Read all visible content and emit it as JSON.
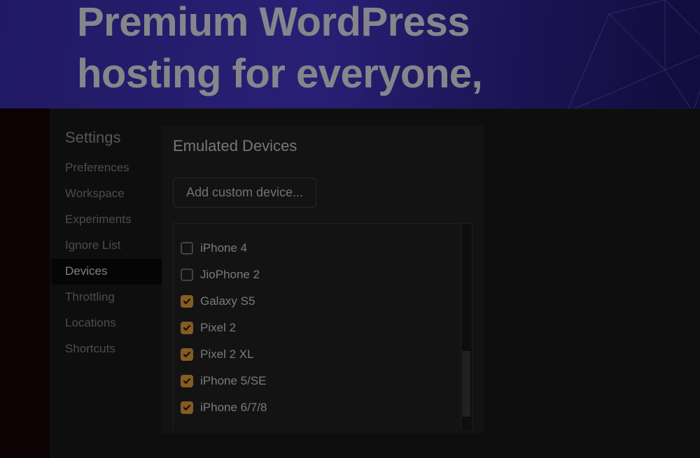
{
  "hero": {
    "title_line1": "Premium WordPress",
    "title_line2": "hosting for everyone,"
  },
  "sidebar": {
    "heading": "Settings",
    "items": [
      {
        "label": "Preferences",
        "active": false
      },
      {
        "label": "Workspace",
        "active": false
      },
      {
        "label": "Experiments",
        "active": false
      },
      {
        "label": "Ignore List",
        "active": false
      },
      {
        "label": "Devices",
        "active": true
      },
      {
        "label": "Throttling",
        "active": false
      },
      {
        "label": "Locations",
        "active": false
      },
      {
        "label": "Shortcuts",
        "active": false
      }
    ]
  },
  "content": {
    "card_title": "Emulated Devices",
    "add_button": "Add custom device...",
    "devices": [
      {
        "label": "iPhone 4",
        "checked": false
      },
      {
        "label": "JioPhone 2",
        "checked": false
      },
      {
        "label": "Galaxy S5",
        "checked": true
      },
      {
        "label": "Pixel 2",
        "checked": true
      },
      {
        "label": "Pixel 2 XL",
        "checked": true
      },
      {
        "label": "iPhone 5/SE",
        "checked": true
      },
      {
        "label": "iPhone 6/7/8",
        "checked": true
      }
    ]
  },
  "colors": {
    "accent_checkbox": "#f2a83c",
    "panel_bg": "#1a1a1c",
    "card_bg": "#232326"
  }
}
